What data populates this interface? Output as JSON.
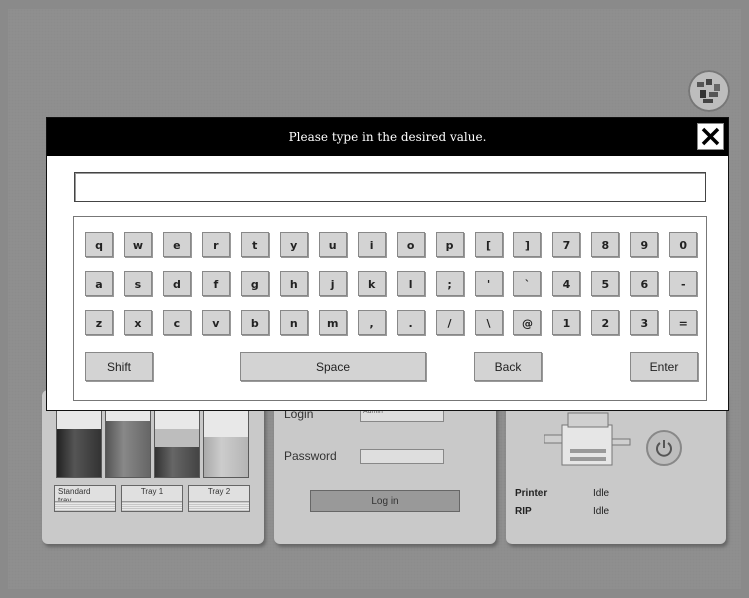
{
  "dialog": {
    "title": "Please type in the desired value.",
    "input_value": ""
  },
  "keyboard": {
    "row1": [
      "q",
      "w",
      "e",
      "r",
      "t",
      "y",
      "u",
      "i",
      "o",
      "p",
      "[",
      "]",
      "7",
      "8",
      "9",
      "0"
    ],
    "row2": [
      "a",
      "s",
      "d",
      "f",
      "g",
      "h",
      "j",
      "k",
      "l",
      ";",
      "'",
      "`",
      "4",
      "5",
      "6",
      "-"
    ],
    "row3": [
      "z",
      "x",
      "c",
      "v",
      "b",
      "n",
      "m",
      ",",
      ".",
      "/",
      "\\",
      "@",
      "1",
      "2",
      "3",
      "="
    ],
    "shift": "Shift",
    "space": "Space",
    "back": "Back",
    "enter": "Enter"
  },
  "trays": {
    "labels": [
      "Standard tray",
      "Tray 1",
      "Tray 2"
    ],
    "standard_line1": "Standard",
    "standard_line2": "tray",
    "tray1": "Tray 1",
    "tray2": "Tray 2"
  },
  "login": {
    "login_label": "Login",
    "login_value": "Admin",
    "password_label": "Password",
    "password_value": "",
    "button": "Log in"
  },
  "status": {
    "printer_label": "Printer",
    "printer_value": "Idle",
    "rip_label": "RIP",
    "rip_value": "Idle"
  },
  "colors": {
    "titlebar": "#000000",
    "key_bg": "#d3d3d3"
  }
}
